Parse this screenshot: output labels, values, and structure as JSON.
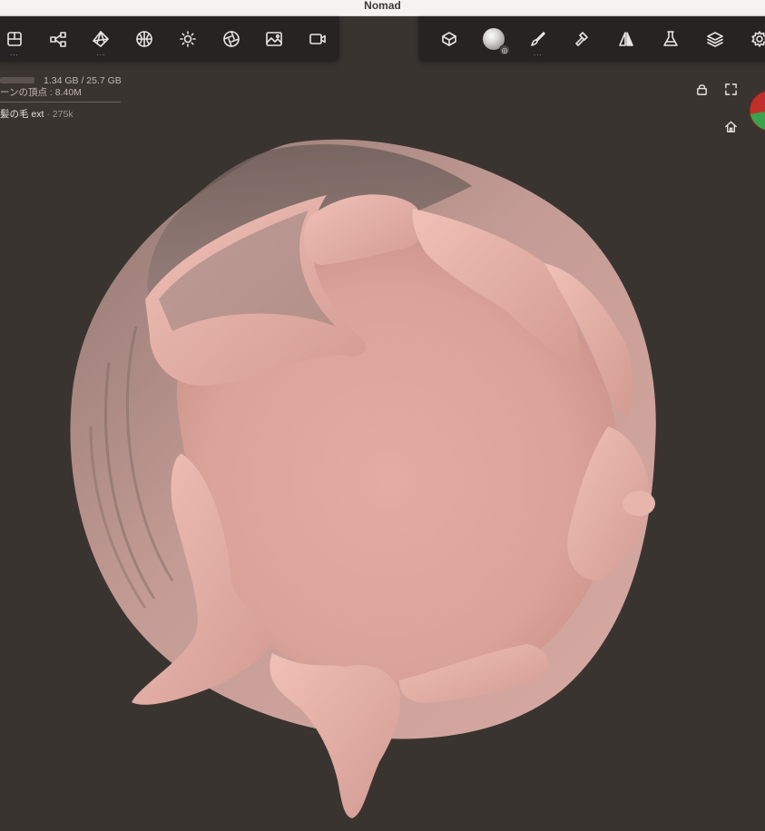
{
  "window": {
    "title": "Nomad"
  },
  "toolbar_left": {
    "tools": [
      {
        "name": "scene-icon",
        "dots": "..."
      },
      {
        "name": "node-graph-icon",
        "dots": ""
      },
      {
        "name": "topology-icon",
        "dots": "..."
      },
      {
        "name": "material-sphere-icon",
        "dots": ""
      },
      {
        "name": "light-icon",
        "dots": ""
      },
      {
        "name": "shading-icon",
        "dots": ""
      },
      {
        "name": "background-icon",
        "dots": ""
      },
      {
        "name": "camera-icon",
        "dots": ""
      }
    ]
  },
  "toolbar_right": {
    "tools": [
      {
        "name": "gizmo-transform-icon",
        "dots": ""
      },
      {
        "name": "brush-alpha-icon",
        "dots": ""
      },
      {
        "name": "brush-icon",
        "dots": "..."
      },
      {
        "name": "hammer-icon",
        "dots": ""
      },
      {
        "name": "symmetry-icon",
        "dots": ""
      },
      {
        "name": "flask-icon",
        "dots": ""
      },
      {
        "name": "layers-icon",
        "dots": ""
      },
      {
        "name": "settings-gear-icon",
        "dots": ""
      }
    ]
  },
  "info": {
    "memory": "1.34 GB / 25.7 GB",
    "vertices": "ーンの頂点 : 8.40M",
    "mesh_name": "髪の毛 ext",
    "mesh_sep": " · ",
    "mesh_count": "275k"
  },
  "viewport_icons": [
    "lock-icon",
    "fullscreen-icon",
    "home-icon"
  ],
  "colors": {
    "background": "#3a3431",
    "toolbar": "#262322",
    "skin": "#e2aca3",
    "hair": "#c4978f",
    "gizmo_red": "#c0302b",
    "gizmo_green": "#3aa24a"
  }
}
